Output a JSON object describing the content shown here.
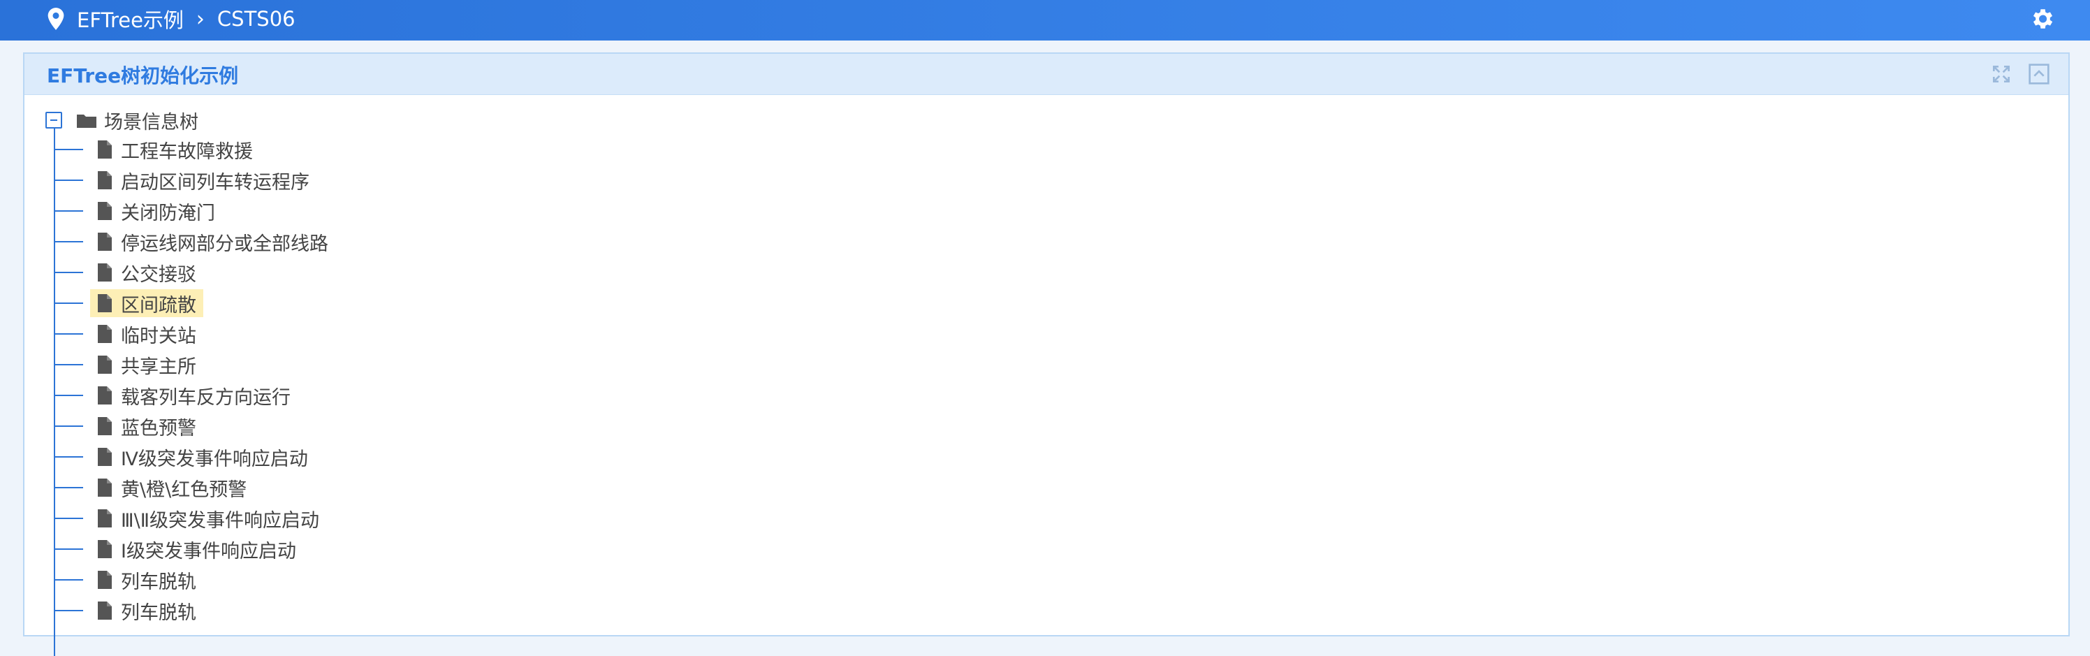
{
  "header": {
    "breadcrumb": [
      "EFTree示例",
      "CSTS06"
    ],
    "icons": [
      "location-pin-icon",
      "chevron-right-icon",
      "gear-icon"
    ]
  },
  "panel": {
    "title": "EFTree树初始化示例",
    "tools": [
      "fullscreen-icon",
      "collapse-up-icon"
    ]
  },
  "tree": {
    "root": "场景信息树",
    "selected_index": 5,
    "children": [
      "工程车故障救援",
      "启动区间列车转运程序",
      "关闭防淹门",
      "停运线网部分或全部线路",
      "公交接驳",
      "区间疏散",
      "临时关站",
      "共享主所",
      "载客列车反方向运行",
      "蓝色预警",
      "Ⅳ级突发事件响应启动",
      "黄\\橙\\红色预警",
      "Ⅲ\\Ⅱ级突发事件响应启动",
      "Ⅰ级突发事件响应启动",
      "列车脱轨",
      "列车脱轨"
    ]
  },
  "colors": {
    "header": "#3e8af0",
    "panel_header": "#dcebfb",
    "title": "#2f7be0",
    "tree_line": "#2c74d6",
    "selected": "#fdefb6"
  }
}
